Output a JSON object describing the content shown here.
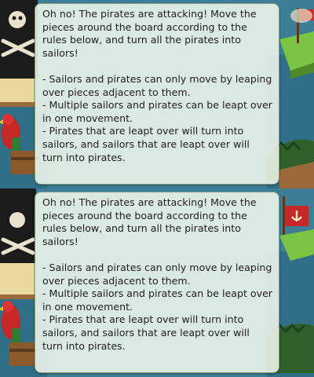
{
  "dialog": {
    "intro": "Oh no! The pirates are attacking! Move the pieces around the board according to the rules below, and turn all the pirates into sailors!",
    "rules": [
      "- Sailors and pirates can only move by leaping over pieces adjacent to them.",
      "- Multiple sailors and pirates can be leapt over in one movement.",
      "- Pirates that are leapt over will turn into sailors, and sailors that are leapt over will turn into pirates."
    ]
  },
  "colors": {
    "sea": "#2e6f8c",
    "dialog_bg": "#f6faf0",
    "dialog_border": "#8a9a7a",
    "text": "#1e1e1e"
  }
}
